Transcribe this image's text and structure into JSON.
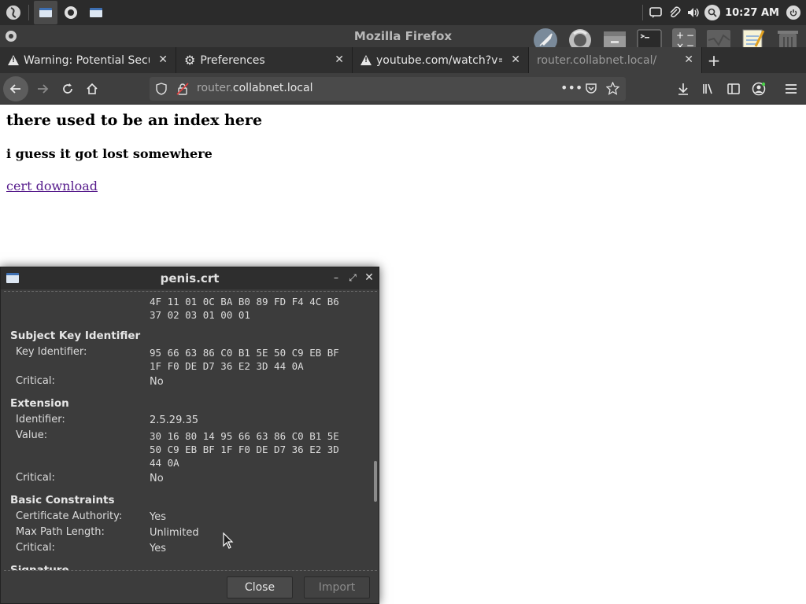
{
  "panel": {
    "clock": "10:27 AM",
    "colors": {
      "bg": "#2b2b2b"
    }
  },
  "window": {
    "title": "Mozilla Firefox"
  },
  "tabs": [
    {
      "label": "Warning: Potential Security Risk Ahead",
      "icon": "warning-icon",
      "active": false
    },
    {
      "label": "Preferences",
      "icon": "gear-icon",
      "active": false
    },
    {
      "label": "youtube.com/watch?v=",
      "icon": "warning-icon",
      "active": false
    },
    {
      "label": "router.collabnet.local/",
      "icon": "",
      "active": true
    }
  ],
  "navbar": {
    "url_domain_prefix": "router.",
    "url_domain_main": "collabnet.local"
  },
  "page": {
    "heading": "there used to be an index here",
    "subheading": "i guess it got lost somewhere",
    "link": "cert download"
  },
  "dialog": {
    "title": "penis.crt",
    "top_value": "4F 11 01 0C BA B0 89 FD F4 4C B6\n37 02 03 01 00 01",
    "sections": [
      {
        "title": "Subject Key Identifier",
        "fields": [
          {
            "label": "Key Identifier:",
            "value": "95 66 63 86 C0 B1 5E 50 C9 EB BF\n1F F0 DE D7 36 E2 3D 44 0A",
            "mono": true
          },
          {
            "label": "Critical:",
            "value": "No",
            "mono": false
          }
        ]
      },
      {
        "title": "Extension",
        "fields": [
          {
            "label": "Identifier:",
            "value": "2.5.29.35",
            "mono": false
          },
          {
            "label": "Value:",
            "value": "30 16 80 14 95 66 63 86 C0 B1 5E\n50 C9 EB BF 1F F0 DE D7 36 E2 3D\n44 0A",
            "mono": true
          },
          {
            "label": "Critical:",
            "value": "No",
            "mono": false
          }
        ]
      },
      {
        "title": "Basic Constraints",
        "fields": [
          {
            "label": "Certificate Authority:",
            "value": "Yes",
            "mono": false
          },
          {
            "label": "Max Path Length:",
            "value": "Unlimited",
            "mono": false
          },
          {
            "label": "Critical:",
            "value": "Yes",
            "mono": false
          }
        ]
      },
      {
        "title": "Signature",
        "fields": []
      }
    ],
    "buttons": {
      "close": "Close",
      "import": "Import"
    }
  }
}
